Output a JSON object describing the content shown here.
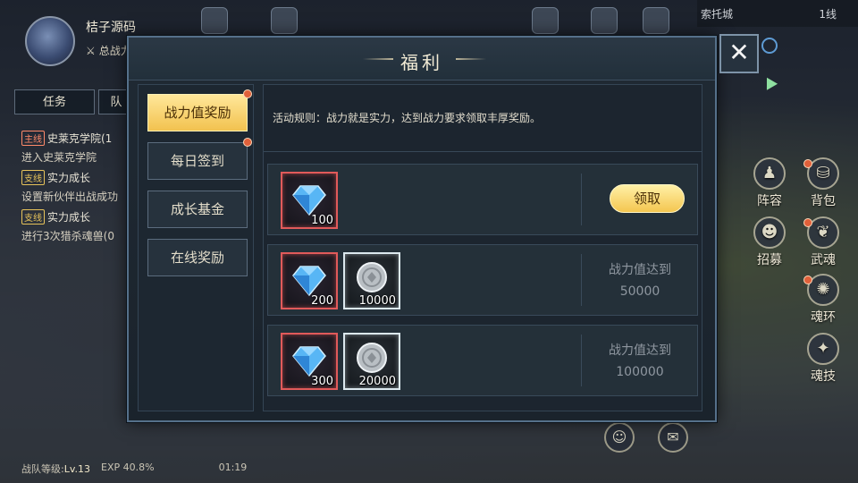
{
  "player": {
    "name": "桔子源码",
    "power_label": "总战力"
  },
  "quest_tabs": [
    "任务",
    "队"
  ],
  "quests": [
    {
      "tag": "主线",
      "title": "史莱克学院(1",
      "desc": "进入史莱克学院"
    },
    {
      "tag": "支线",
      "title": "实力成长",
      "desc": "设置新伙伴出战成功"
    },
    {
      "tag": "支线",
      "title": "实力成长",
      "desc": "进行3次猎杀魂兽(0"
    }
  ],
  "map": {
    "name": "索托城",
    "line": "1线"
  },
  "side_menu": [
    {
      "label": "阵容",
      "icon": "formation-icon"
    },
    {
      "label": "背包",
      "icon": "backpack-icon"
    },
    {
      "label": "招募",
      "icon": "recruit-icon"
    },
    {
      "label": "武魂",
      "icon": "martial-soul-icon"
    },
    {
      "label": "魂环",
      "icon": "soul-ring-icon"
    },
    {
      "label": "魂技",
      "icon": "soul-skill-icon"
    }
  ],
  "bottom": {
    "team_level_label": "战队等级:",
    "team_level": "Lv.13",
    "exp_label": "EXP",
    "exp": "40.8%",
    "time": "01:19"
  },
  "modal": {
    "title": "福利",
    "tabs": [
      {
        "label": "战力值奖励",
        "active": true,
        "dot": true
      },
      {
        "label": "每日签到",
        "active": false,
        "dot": true
      },
      {
        "label": "成长基金",
        "active": false,
        "dot": false
      },
      {
        "label": "在线奖励",
        "active": false,
        "dot": false
      }
    ],
    "rules": "活动规则：战力就是实力，达到战力要求领取丰厚奖励。",
    "rewards": [
      {
        "items": [
          {
            "type": "diamond",
            "qty": "100"
          }
        ],
        "action": "领取"
      },
      {
        "items": [
          {
            "type": "diamond",
            "qty": "200"
          },
          {
            "type": "coin",
            "qty": "10000"
          }
        ],
        "req_label": "战力值达到",
        "req_value": "50000"
      },
      {
        "items": [
          {
            "type": "diamond",
            "qty": "300"
          },
          {
            "type": "coin",
            "qty": "20000"
          }
        ],
        "req_label": "战力值达到",
        "req_value": "100000"
      }
    ],
    "close_label": "✕"
  },
  "colors": {
    "accent_gold": "#f2c24f",
    "frame_blue": "#55708a",
    "rarity_red": "#e15a5a",
    "rarity_white": "#dce8ee",
    "dot_orange": "#e0603a"
  }
}
